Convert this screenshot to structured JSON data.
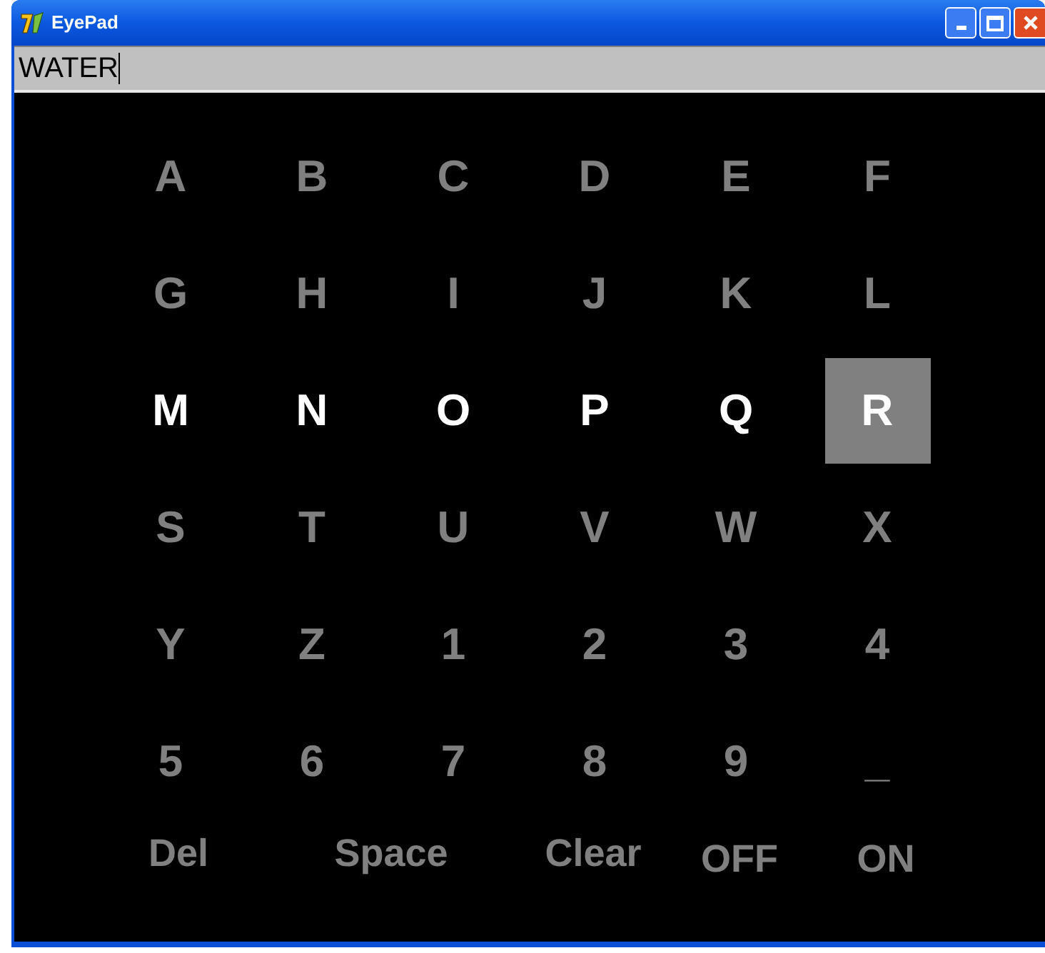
{
  "window": {
    "title": "EyePad"
  },
  "text_field": {
    "value": "WATER"
  },
  "keypad": {
    "rows": [
      {
        "highlighted": false,
        "keys": [
          {
            "label": "A",
            "selected": false
          },
          {
            "label": "B",
            "selected": false
          },
          {
            "label": "C",
            "selected": false
          },
          {
            "label": "D",
            "selected": false
          },
          {
            "label": "E",
            "selected": false
          },
          {
            "label": "F",
            "selected": false
          }
        ]
      },
      {
        "highlighted": false,
        "keys": [
          {
            "label": "G",
            "selected": false
          },
          {
            "label": "H",
            "selected": false
          },
          {
            "label": "I",
            "selected": false
          },
          {
            "label": "J",
            "selected": false
          },
          {
            "label": "K",
            "selected": false
          },
          {
            "label": "L",
            "selected": false
          }
        ]
      },
      {
        "highlighted": true,
        "keys": [
          {
            "label": "M",
            "selected": false
          },
          {
            "label": "N",
            "selected": false
          },
          {
            "label": "O",
            "selected": false
          },
          {
            "label": "P",
            "selected": false
          },
          {
            "label": "Q",
            "selected": false
          },
          {
            "label": "R",
            "selected": true
          }
        ]
      },
      {
        "highlighted": false,
        "keys": [
          {
            "label": "S",
            "selected": false
          },
          {
            "label": "T",
            "selected": false
          },
          {
            "label": "U",
            "selected": false
          },
          {
            "label": "V",
            "selected": false
          },
          {
            "label": "W",
            "selected": false
          },
          {
            "label": "X",
            "selected": false
          }
        ]
      },
      {
        "highlighted": false,
        "keys": [
          {
            "label": "Y",
            "selected": false
          },
          {
            "label": "Z",
            "selected": false
          },
          {
            "label": "1",
            "selected": false
          },
          {
            "label": "2",
            "selected": false
          },
          {
            "label": "3",
            "selected": false
          },
          {
            "label": "4",
            "selected": false
          }
        ]
      },
      {
        "highlighted": false,
        "keys": [
          {
            "label": "5",
            "selected": false
          },
          {
            "label": "6",
            "selected": false
          },
          {
            "label": "7",
            "selected": false
          },
          {
            "label": "8",
            "selected": false
          },
          {
            "label": "9",
            "selected": false
          },
          {
            "label": "_",
            "selected": false
          }
        ]
      }
    ]
  },
  "buttons": [
    {
      "label": "Del"
    },
    {
      "label": "Space"
    },
    {
      "label": "Clear"
    },
    {
      "label": "OFF"
    },
    {
      "label": "ON"
    }
  ]
}
